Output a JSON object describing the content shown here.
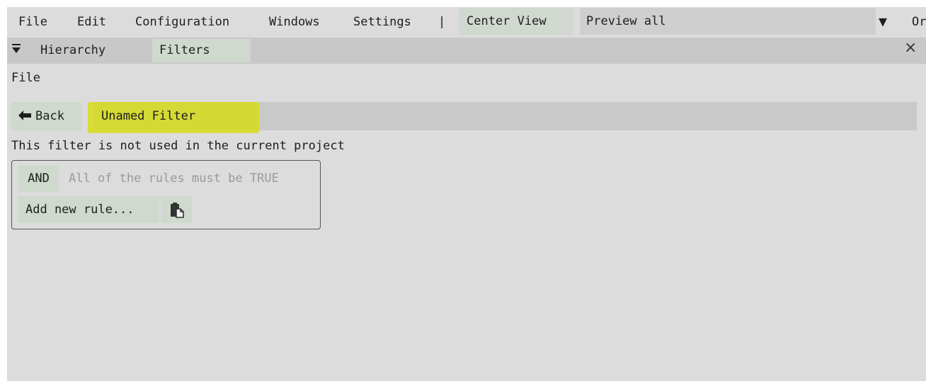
{
  "menubar": {
    "items": [
      "File",
      "Edit",
      "Configuration",
      "Windows",
      "Settings"
    ],
    "separator": "|",
    "center_view": "Center View",
    "preview_value": "Preview all",
    "dropdown_glyph": "▼",
    "clipped_text": "Or"
  },
  "tabs": {
    "collapse_glyph": "▼",
    "items": [
      "Hierarchy",
      "Filters"
    ],
    "active": "Filters",
    "close_glyph": "×"
  },
  "panel": {
    "section_label": "File",
    "back_label": "Back",
    "back_glyph": "🡐",
    "filter_name": "Unamed Filter",
    "usage_info": "This filter is not used in the current project",
    "rule_group": {
      "operator": "AND",
      "description": "All of the rules must be TRUE",
      "add_rule_label": "Add new rule..."
    }
  },
  "colors": {
    "panel_bg": "#dcdcdc",
    "button_bg": "#cfd9cd",
    "highlight": "#d6dc1a"
  },
  "icons": {
    "paste": "paste-icon",
    "close": "close-icon",
    "back": "arrow-left-icon",
    "collapse": "triangle-down-icon"
  }
}
